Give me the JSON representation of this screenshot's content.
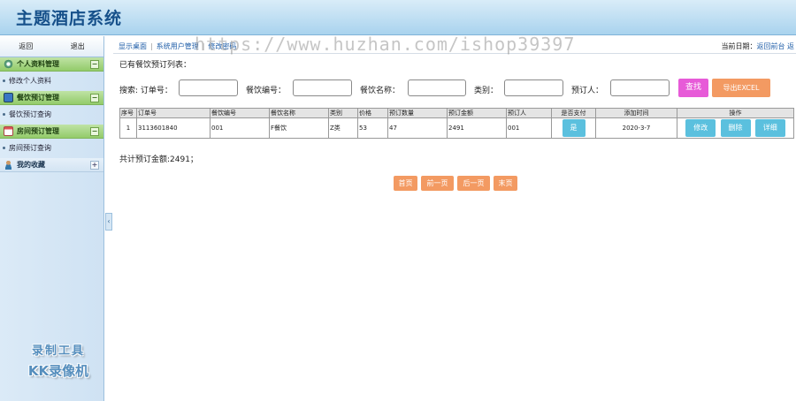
{
  "header": {
    "title": "主题酒店系统"
  },
  "sidebar": {
    "back_label": "返回",
    "logout_label": "退出",
    "groups": [
      {
        "title": "个人资料管理",
        "toggle": "−",
        "items": [
          "修改个人资料"
        ]
      },
      {
        "title": "餐饮预订管理",
        "toggle": "−",
        "items": [
          "餐饮预订查询"
        ]
      },
      {
        "title": "房间预订管理",
        "toggle": "−",
        "items": [
          "房间预订查询"
        ]
      },
      {
        "title": "我的收藏",
        "toggle": "+",
        "items": []
      }
    ],
    "collapse_glyph": "‹"
  },
  "watermark": {
    "url": "https://www.huzhan.com/ishop39397",
    "line1": "录制工具",
    "line2": "KK录像机"
  },
  "topbar": {
    "crumbs": [
      "显示桌面",
      "系统用户管理",
      "修改密码"
    ],
    "date_label": "当前日期：",
    "back_front": "返回前台",
    "date_trail": "返"
  },
  "main": {
    "list_title": "已有餐饮预订列表：",
    "search": {
      "order_label": "搜索: 订单号：",
      "code_label": "餐饮编号：",
      "name_label": "餐饮名称：",
      "type_label": "类别：",
      "booker_label": "预订人：",
      "find_label": "查找",
      "excel_label": "导出EXCEL"
    },
    "table": {
      "headers": [
        "序号",
        "订单号",
        "餐饮编号",
        "餐饮名称",
        "类别",
        "价格",
        "预订数量",
        "预订金额",
        "预订人",
        "是否支付",
        "添加时间",
        "操作"
      ],
      "rows": [
        {
          "no": "1",
          "order": "3113601840",
          "code": "001",
          "name": "F餐饮",
          "type": "Z类",
          "price": "53",
          "qty": "47",
          "amount": "2491",
          "booker": "001",
          "paid": "是",
          "time": "2020-3-7"
        }
      ],
      "actions": {
        "edit": "修改",
        "delete": "删除",
        "detail": "详细"
      }
    },
    "total": "共计预订金额:2491；",
    "pager": {
      "first": "首页",
      "prev": "前一页",
      "next": "后一页",
      "last": "末页"
    }
  }
}
